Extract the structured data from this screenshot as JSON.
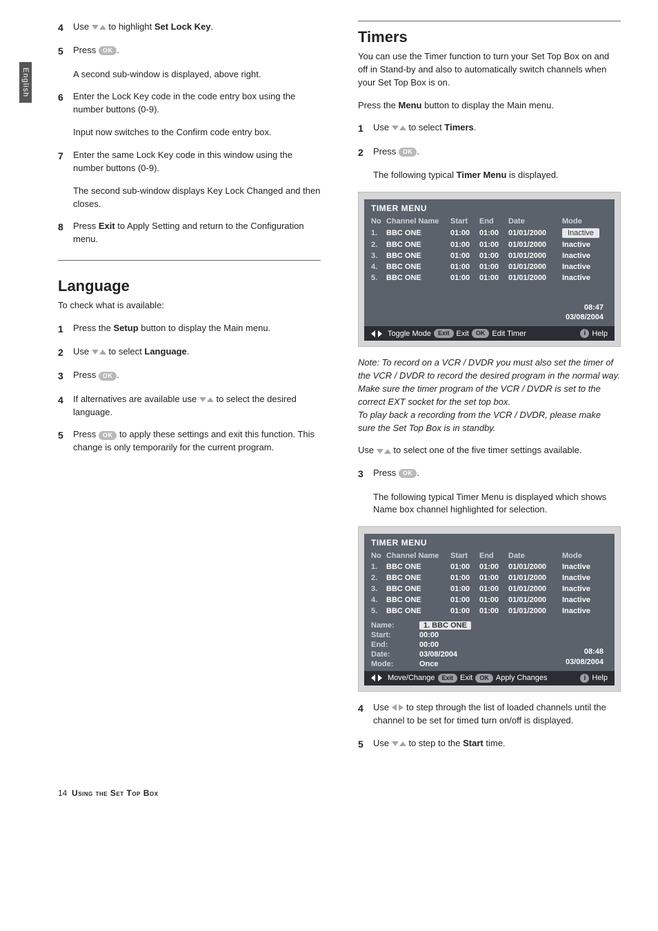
{
  "sideTab": "English",
  "left": {
    "steps1": [
      {
        "n": "4",
        "pre": "Use ",
        "icon": "ud",
        "mid": " to highlight ",
        "boldMid": "Set Lock Key",
        "post": "."
      },
      {
        "n": "5",
        "pre": "Press ",
        "icon": "ok",
        "post": "."
      }
    ],
    "p1": "A second sub-window is displayed, above right.",
    "steps2": [
      {
        "n": "6",
        "text": "Enter the Lock Key code in the code entry box using the number buttons (0-9)."
      }
    ],
    "p2": "Input now switches to the Confirm code entry box.",
    "steps3": [
      {
        "n": "7",
        "text": "Enter the same Lock Key code in this window using the number buttons (0-9)."
      }
    ],
    "p3": "The second sub-window displays Key Lock Changed and then closes.",
    "steps4": [
      {
        "n": "8",
        "pre": "Press ",
        "bold": "Exit",
        "post": " to Apply Setting and return to the Configuration menu."
      }
    ],
    "langHeading": "Language",
    "langIntro": "To check what is available:",
    "langSteps": {
      "s1": {
        "n": "1",
        "pre": "Press the ",
        "bold": "Setup",
        "post": " button to display the Main menu."
      },
      "s2": {
        "n": "2",
        "pre": "Use ",
        "icon": "ud",
        "mid": " to select ",
        "boldMid": "Language",
        "post": "."
      },
      "s3": {
        "n": "3",
        "pre": "Press ",
        "icon": "ok",
        "post": "."
      },
      "s4": {
        "n": "4",
        "pre": "If alternatives are available use ",
        "icon": "ud",
        "post": " to select the desired language."
      },
      "s5": {
        "n": "5",
        "pre": "Press ",
        "icon": "ok",
        "post": " to apply these settings and exit this function. This change is only temporarily for the current program."
      }
    }
  },
  "right": {
    "heading": "Timers",
    "intro1": "You can use the Timer function to turn your Set Top Box on and off in Stand-by and also to automatically switch channels when your Set Top Box is on.",
    "intro2_pre": "Press the ",
    "intro2_bold": "Menu",
    "intro2_post": " button to display the Main menu.",
    "steps": {
      "s1": {
        "n": "1",
        "pre": "Use ",
        "mid": " to select ",
        "boldMid": "Timers",
        "post": "."
      },
      "s2": {
        "n": "2",
        "pre": "Press ",
        "post": "."
      },
      "s3": {
        "n": "3",
        "pre": "Press ",
        "post": "."
      },
      "s4": {
        "n": "4",
        "pre": "Use ",
        "post": " to step through the list of loaded channels until the channel to be set for timed turn on/off is displayed."
      },
      "s5": {
        "n": "5",
        "pre": "Use ",
        "mid": " to step to the ",
        "boldMid": "Start",
        "post": " time."
      }
    },
    "afterS2_pre": "The following typical ",
    "afterS2_bold": "Timer Menu",
    "afterS2_post": " is displayed.",
    "note": "Note: To record on a VCR / DVDR you must also set the timer of the VCR / DVDR to record the desired program in the normal way. Make sure the timer program of the VCR / DVDR is set to the correct EXT socket for the set top box.\nTo play back a recording from the VCR / DVDR, please make sure the Set Top Box is in standby.",
    "useUD": "Use ",
    "useUD_post": " to select one of the five timer settings available.",
    "afterS3": "The following typical Timer Menu is displayed which shows Name box channel highlighted for selection."
  },
  "menu1": {
    "title": "TIMER MENU",
    "headers": {
      "no": "No",
      "name": "Channel Name",
      "start": "Start",
      "end": "End",
      "date": "Date",
      "mode": "Mode"
    },
    "rows": [
      {
        "no": "1.",
        "name": "BBC ONE",
        "start": "01:00",
        "end": "01:00",
        "date": "01/01/2000",
        "mode": "Inactive",
        "sel": true
      },
      {
        "no": "2.",
        "name": "BBC ONE",
        "start": "01:00",
        "end": "01:00",
        "date": "01/01/2000",
        "mode": "Inactive"
      },
      {
        "no": "3.",
        "name": "BBC ONE",
        "start": "01:00",
        "end": "01:00",
        "date": "01/01/2000",
        "mode": "Inactive"
      },
      {
        "no": "4.",
        "name": "BBC ONE",
        "start": "01:00",
        "end": "01:00",
        "date": "01/01/2000",
        "mode": "Inactive"
      },
      {
        "no": "5.",
        "name": "BBC ONE",
        "start": "01:00",
        "end": "01:00",
        "date": "01/01/2000",
        "mode": "Inactive"
      }
    ],
    "clock": {
      "time": "08:47",
      "date": "03/08/2004"
    },
    "foot": {
      "toggle": "Toggle Mode",
      "exitPill": "Exit",
      "exit": "Exit",
      "okPill": "OK",
      "action": "Edit Timer",
      "help": "Help"
    }
  },
  "menu2": {
    "title": "TIMER MENU",
    "headers": {
      "no": "No",
      "name": "Channel Name",
      "start": "Start",
      "end": "End",
      "date": "Date",
      "mode": "Mode"
    },
    "rows": [
      {
        "no": "1.",
        "name": "BBC ONE",
        "start": "01:00",
        "end": "01:00",
        "date": "01/01/2000",
        "mode": "Inactive"
      },
      {
        "no": "2.",
        "name": "BBC ONE",
        "start": "01:00",
        "end": "01:00",
        "date": "01/01/2000",
        "mode": "Inactive"
      },
      {
        "no": "3.",
        "name": "BBC ONE",
        "start": "01:00",
        "end": "01:00",
        "date": "01/01/2000",
        "mode": "Inactive"
      },
      {
        "no": "4.",
        "name": "BBC ONE",
        "start": "01:00",
        "end": "01:00",
        "date": "01/01/2000",
        "mode": "Inactive"
      },
      {
        "no": "5.",
        "name": "BBC ONE",
        "start": "01:00",
        "end": "01:00",
        "date": "01/01/2000",
        "mode": "Inactive"
      }
    ],
    "edit": {
      "nameLbl": "Name:",
      "nameVal": "1. BBC ONE",
      "startLbl": "Start:",
      "startVal": "00:00",
      "endLbl": "End:",
      "endVal": "00:00",
      "dateLbl": "Date:",
      "dateVal": "03/08/2004",
      "modeLbl": "Mode:",
      "modeVal": "Once"
    },
    "clock": {
      "time": "08:48",
      "date": "03/08/2004"
    },
    "foot": {
      "toggle": "Move/Change",
      "exitPill": "Exit",
      "exit": "Exit",
      "okPill": "OK",
      "action": "Apply Changes",
      "help": "Help"
    }
  },
  "icons": {
    "ok": "OK",
    "exit": "Exit"
  },
  "footer": {
    "page": "14",
    "title": "Using the Set Top Box"
  }
}
